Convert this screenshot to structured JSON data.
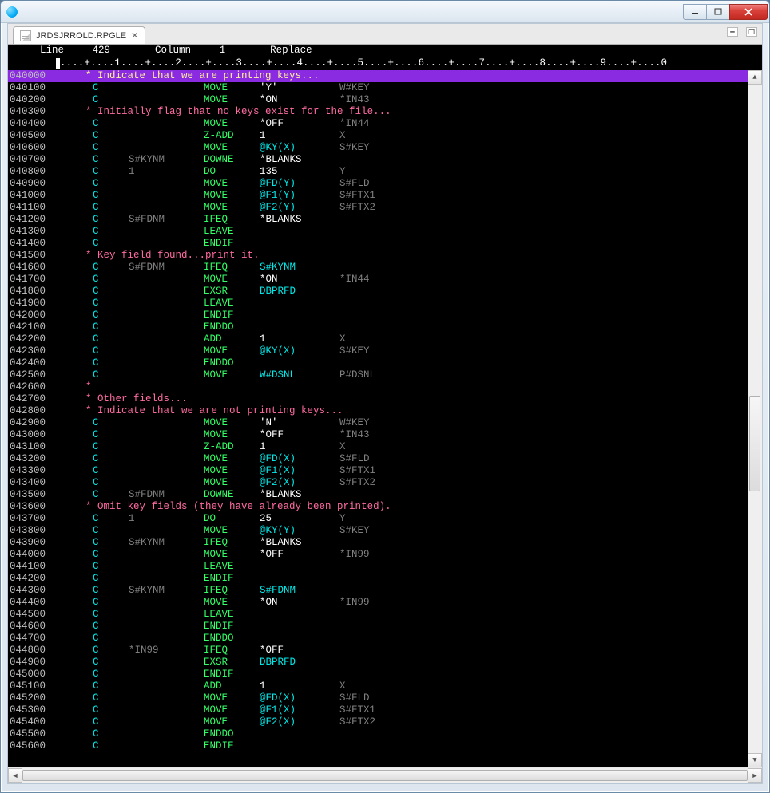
{
  "window": {
    "title": ""
  },
  "tab": {
    "label": "JRDSJRROLD.RPGLE"
  },
  "status": {
    "line_label": "Line",
    "line_value": "429",
    "column_label": "Column",
    "column_value": "1",
    "mode": "Replace"
  },
  "ruler": "....+....1....+....2....+....3....+....4....+....5....+....6....+....7....+....8....+....9....+....0",
  "lines": [
    {
      "n": "040000",
      "type": "cmt_hl",
      "text": "      * Indicate that we are printing keys..."
    },
    {
      "n": "040100",
      "type": "c",
      "f1": "",
      "op": "MOVE",
      "f2": "'Y'",
      "f2c": "w",
      "res": "W#KEY"
    },
    {
      "n": "040200",
      "type": "c",
      "f1": "",
      "op": "MOVE",
      "f2": "*ON",
      "f2c": "w",
      "res": "*IN43"
    },
    {
      "n": "040300",
      "type": "cmt",
      "text": "      * Initially flag that no keys exist for the file..."
    },
    {
      "n": "040400",
      "type": "c",
      "f1": "",
      "op": "MOVE",
      "f2": "*OFF",
      "f2c": "w",
      "res": "*IN44"
    },
    {
      "n": "040500",
      "type": "c",
      "f1": "",
      "op": "Z-ADD",
      "f2": "1",
      "f2c": "w",
      "res": "X"
    },
    {
      "n": "040600",
      "type": "c",
      "f1": "",
      "op": "MOVE",
      "f2": "@KY(X)",
      "f2c": "c",
      "res": "S#KEY"
    },
    {
      "n": "040700",
      "type": "c",
      "f1": "S#KYNM",
      "op": "DOWNE",
      "f2": "*BLANKS",
      "f2c": "w",
      "res": ""
    },
    {
      "n": "040800",
      "type": "c",
      "f1": "1",
      "op": "DO",
      "f2": "135",
      "f2c": "w",
      "res": "Y"
    },
    {
      "n": "040900",
      "type": "c",
      "f1": "",
      "op": "MOVE",
      "f2": "@FD(Y)",
      "f2c": "c",
      "res": "S#FLD"
    },
    {
      "n": "041000",
      "type": "c",
      "f1": "",
      "op": "MOVE",
      "f2": "@F1(Y)",
      "f2c": "c",
      "res": "S#FTX1"
    },
    {
      "n": "041100",
      "type": "c",
      "f1": "",
      "op": "MOVE",
      "f2": "@F2(Y)",
      "f2c": "c",
      "res": "S#FTX2"
    },
    {
      "n": "041200",
      "type": "c",
      "f1": "S#FDNM",
      "op": "IFEQ",
      "f2": "*BLANKS",
      "f2c": "w",
      "res": ""
    },
    {
      "n": "041300",
      "type": "c",
      "f1": "",
      "op": "LEAVE",
      "f2": "",
      "f2c": "w",
      "res": ""
    },
    {
      "n": "041400",
      "type": "c",
      "f1": "",
      "op": "ENDIF",
      "f2": "",
      "f2c": "w",
      "res": ""
    },
    {
      "n": "041500",
      "type": "cmt",
      "text": "      * Key field found...print it."
    },
    {
      "n": "041600",
      "type": "c",
      "f1": "S#FDNM",
      "op": "IFEQ",
      "f2": "S#KYNM",
      "f2c": "c",
      "res": ""
    },
    {
      "n": "041700",
      "type": "c",
      "f1": "",
      "op": "MOVE",
      "f2": "*ON",
      "f2c": "w",
      "res": "*IN44"
    },
    {
      "n": "041800",
      "type": "c",
      "f1": "",
      "op": "EXSR",
      "f2": "DBPRFD",
      "f2c": "c",
      "res": ""
    },
    {
      "n": "041900",
      "type": "c",
      "f1": "",
      "op": "LEAVE",
      "f2": "",
      "f2c": "w",
      "res": ""
    },
    {
      "n": "042000",
      "type": "c",
      "f1": "",
      "op": "ENDIF",
      "f2": "",
      "f2c": "w",
      "res": ""
    },
    {
      "n": "042100",
      "type": "c",
      "f1": "",
      "op": "ENDDO",
      "f2": "",
      "f2c": "w",
      "res": ""
    },
    {
      "n": "042200",
      "type": "c",
      "f1": "",
      "op": "ADD",
      "f2": "1",
      "f2c": "w",
      "res": "X"
    },
    {
      "n": "042300",
      "type": "c",
      "f1": "",
      "op": "MOVE",
      "f2": "@KY(X)",
      "f2c": "c",
      "res": "S#KEY"
    },
    {
      "n": "042400",
      "type": "c",
      "f1": "",
      "op": "ENDDO",
      "f2": "",
      "f2c": "w",
      "res": ""
    },
    {
      "n": "042500",
      "type": "c",
      "f1": "",
      "op": "MOVE",
      "f2": "W#DSNL",
      "f2c": "c",
      "res": "P#DSNL"
    },
    {
      "n": "042600",
      "type": "cmt",
      "text": "      *"
    },
    {
      "n": "042700",
      "type": "cmt",
      "text": "      * Other fields..."
    },
    {
      "n": "042800",
      "type": "cmt",
      "text": "      * Indicate that we are not printing keys..."
    },
    {
      "n": "042900",
      "type": "c",
      "f1": "",
      "op": "MOVE",
      "f2": "'N'",
      "f2c": "w",
      "res": "W#KEY"
    },
    {
      "n": "043000",
      "type": "c",
      "f1": "",
      "op": "MOVE",
      "f2": "*OFF",
      "f2c": "w",
      "res": "*IN43"
    },
    {
      "n": "043100",
      "type": "c",
      "f1": "",
      "op": "Z-ADD",
      "f2": "1",
      "f2c": "w",
      "res": "X"
    },
    {
      "n": "043200",
      "type": "c",
      "f1": "",
      "op": "MOVE",
      "f2": "@FD(X)",
      "f2c": "c",
      "res": "S#FLD"
    },
    {
      "n": "043300",
      "type": "c",
      "f1": "",
      "op": "MOVE",
      "f2": "@F1(X)",
      "f2c": "c",
      "res": "S#FTX1"
    },
    {
      "n": "043400",
      "type": "c",
      "f1": "",
      "op": "MOVE",
      "f2": "@F2(X)",
      "f2c": "c",
      "res": "S#FTX2"
    },
    {
      "n": "043500",
      "type": "c",
      "f1": "S#FDNM",
      "op": "DOWNE",
      "f2": "*BLANKS",
      "f2c": "w",
      "res": ""
    },
    {
      "n": "043600",
      "type": "cmt",
      "text": "      * Omit key fields (they have already been printed)."
    },
    {
      "n": "043700",
      "type": "c",
      "f1": "1",
      "op": "DO",
      "f2": "25",
      "f2c": "w",
      "res": "Y"
    },
    {
      "n": "043800",
      "type": "c",
      "f1": "",
      "op": "MOVE",
      "f2": "@KY(Y)",
      "f2c": "c",
      "res": "S#KEY"
    },
    {
      "n": "043900",
      "type": "c",
      "f1": "S#KYNM",
      "op": "IFEQ",
      "f2": "*BLANKS",
      "f2c": "w",
      "res": ""
    },
    {
      "n": "044000",
      "type": "c",
      "f1": "",
      "op": "MOVE",
      "f2": "*OFF",
      "f2c": "w",
      "res": "*IN99"
    },
    {
      "n": "044100",
      "type": "c",
      "f1": "",
      "op": "LEAVE",
      "f2": "",
      "f2c": "w",
      "res": ""
    },
    {
      "n": "044200",
      "type": "c",
      "f1": "",
      "op": "ENDIF",
      "f2": "",
      "f2c": "w",
      "res": ""
    },
    {
      "n": "044300",
      "type": "c",
      "f1": "S#KYNM",
      "op": "IFEQ",
      "f2": "S#FDNM",
      "f2c": "c",
      "res": ""
    },
    {
      "n": "044400",
      "type": "c",
      "f1": "",
      "op": "MOVE",
      "f2": "*ON",
      "f2c": "w",
      "res": "*IN99"
    },
    {
      "n": "044500",
      "type": "c",
      "f1": "",
      "op": "LEAVE",
      "f2": "",
      "f2c": "w",
      "res": ""
    },
    {
      "n": "044600",
      "type": "c",
      "f1": "",
      "op": "ENDIF",
      "f2": "",
      "f2c": "w",
      "res": ""
    },
    {
      "n": "044700",
      "type": "c",
      "f1": "",
      "op": "ENDDO",
      "f2": "",
      "f2c": "w",
      "res": ""
    },
    {
      "n": "044800",
      "type": "c",
      "f1": "*IN99",
      "op": "IFEQ",
      "f2": "*OFF",
      "f2c": "w",
      "res": ""
    },
    {
      "n": "044900",
      "type": "c",
      "f1": "",
      "op": "EXSR",
      "f2": "DBPRFD",
      "f2c": "c",
      "res": ""
    },
    {
      "n": "045000",
      "type": "c",
      "f1": "",
      "op": "ENDIF",
      "f2": "",
      "f2c": "w",
      "res": ""
    },
    {
      "n": "045100",
      "type": "c",
      "f1": "",
      "op": "ADD",
      "f2": "1",
      "f2c": "w",
      "res": "X"
    },
    {
      "n": "045200",
      "type": "c",
      "f1": "",
      "op": "MOVE",
      "f2": "@FD(X)",
      "f2c": "c",
      "res": "S#FLD"
    },
    {
      "n": "045300",
      "type": "c",
      "f1": "",
      "op": "MOVE",
      "f2": "@F1(X)",
      "f2c": "c",
      "res": "S#FTX1"
    },
    {
      "n": "045400",
      "type": "c",
      "f1": "",
      "op": "MOVE",
      "f2": "@F2(X)",
      "f2c": "c",
      "res": "S#FTX2"
    },
    {
      "n": "045500",
      "type": "c",
      "f1": "",
      "op": "ENDDO",
      "f2": "",
      "f2c": "w",
      "res": ""
    },
    {
      "n": "045600",
      "type": "c",
      "f1": "",
      "op": "ENDIF",
      "f2": "",
      "f2c": "w",
      "res": ""
    }
  ]
}
